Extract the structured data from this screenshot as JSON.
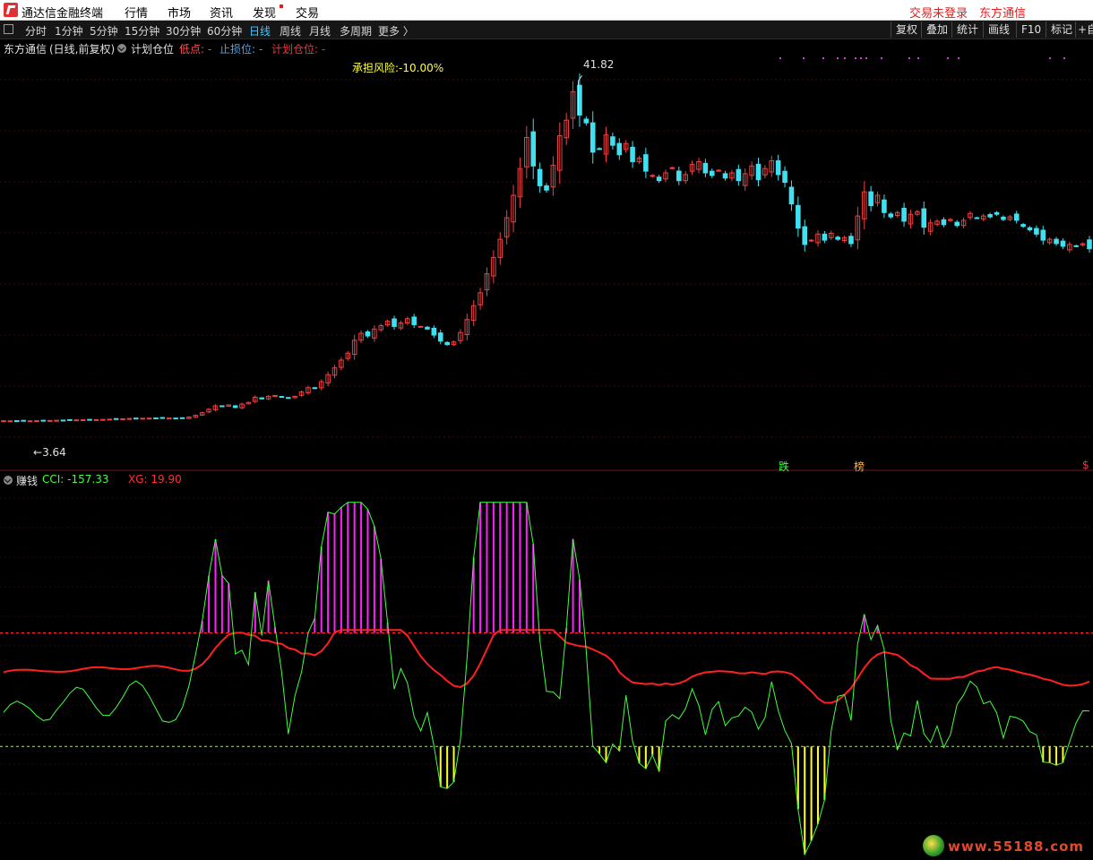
{
  "menubar": {
    "app_name": "通达信金融终端",
    "items": [
      "行情",
      "市场",
      "资讯",
      "发现",
      "交易"
    ],
    "login": "交易未登录",
    "broker": "东方通信"
  },
  "toolbar": {
    "periods": [
      "分时",
      "1分钟",
      "5分钟",
      "15分钟",
      "30分钟",
      "60分钟",
      "日线",
      "周线",
      "月线",
      "多周期",
      "更多 〉"
    ],
    "active": "日线",
    "right_buttons": [
      "复权",
      "叠加",
      "统计",
      "画线",
      "F10",
      "标记",
      "+自"
    ]
  },
  "info": {
    "stock": "东方通信",
    "mode": "(日线,前复权)",
    "indicator": "计划仓位",
    "low_label": "低点: -",
    "stop_label": "止损位: -",
    "plan_label": "计划仓位: -",
    "risk_text": "承担风险:-10.00%",
    "high_value": "41.82",
    "low_value": "3.64",
    "marker_die": "跌",
    "marker_bang": "榜",
    "marker_dollar": "$"
  },
  "indicator": {
    "name": "赚钱",
    "cci_label": "CCI: -157.33",
    "xg_label": "XG: 19.90"
  },
  "watermark": "www.55188.com",
  "colors": {
    "up": "#f04040",
    "down": "#40e0f0",
    "cci": "#40ff40",
    "xg": "#ff2020",
    "overbought": "#ff20ff",
    "oversold": "#ffff20"
  },
  "chart_data": {
    "type": "candlestick",
    "price_series": {
      "close": [
        3.67,
        3.66,
        3.65,
        3.64,
        3.66,
        3.68,
        3.69,
        3.7,
        3.72,
        3.73,
        3.75,
        3.77,
        3.78,
        3.79,
        3.8,
        3.82,
        3.85,
        3.88,
        3.9,
        3.93,
        3.95,
        3.96,
        3.97,
        3.97,
        3.96,
        3.98,
        3.97,
        4.0,
        4.1,
        4.3,
        4.6,
        5.0,
        5.4,
        5.3,
        5.5,
        5.2,
        5.6,
        5.8,
        6.4,
        6.2,
        6.5,
        6.6,
        6.4,
        6.3,
        6.5,
        7.0,
        7.5,
        7.4,
        8.2,
        9.0,
        9.8,
        10.7,
        11.5,
        13.0,
        13.8,
        13.5,
        14.3,
        14.7,
        15.2,
        14.6,
        15.0,
        15.5,
        14.8,
        14.6,
        14.3,
        13.6,
        12.9,
        12.5,
        12.8,
        13.9,
        15.4,
        17.0,
        18.5,
        20.7,
        22.6,
        24.7,
        27.2,
        29.8,
        32.9,
        36.5,
        33.2,
        30.9,
        30.4,
        33.3,
        36.7,
        38.5,
        41.8,
        39.1,
        38.2,
        34.8,
        35.2,
        36.8,
        35.6,
        34.5,
        35.8,
        33.7,
        34.1,
        32.6,
        32.1,
        31.5,
        32.4,
        33.0,
        31.5,
        32.2,
        33.4,
        33.7,
        32.4,
        32.1,
        32.7,
        31.8,
        32.4,
        31.5,
        32.3,
        33.2,
        31.6,
        32.9,
        33.8,
        32.2,
        31.3,
        28.8,
        26.0,
        24.1,
        24.6,
        25.3,
        24.6,
        25.4,
        24.7,
        24.9,
        24.2,
        27.4,
        30.2,
        28.6,
        29.8,
        27.8,
        27.3,
        27.8,
        26.8,
        27.6,
        27.9,
        26.1,
        26.6,
        26.8,
        26.4,
        27.0,
        26.3,
        26.9,
        27.7,
        27.2,
        27.4,
        27.3,
        27.6,
        27.0,
        27.3,
        26.9,
        26.2,
        25.8,
        25.3,
        24.6,
        24.7,
        24.2,
        23.9,
        24.1,
        23.9,
        24.2,
        23.6
      ]
    },
    "price_range": [
      0,
      46
    ],
    "cci_range": [
      -300,
      350
    ],
    "levels": {
      "cci_upper": 100,
      "cci_lower": -100
    },
    "high_marker": 41.82,
    "low_marker": 3.64
  }
}
